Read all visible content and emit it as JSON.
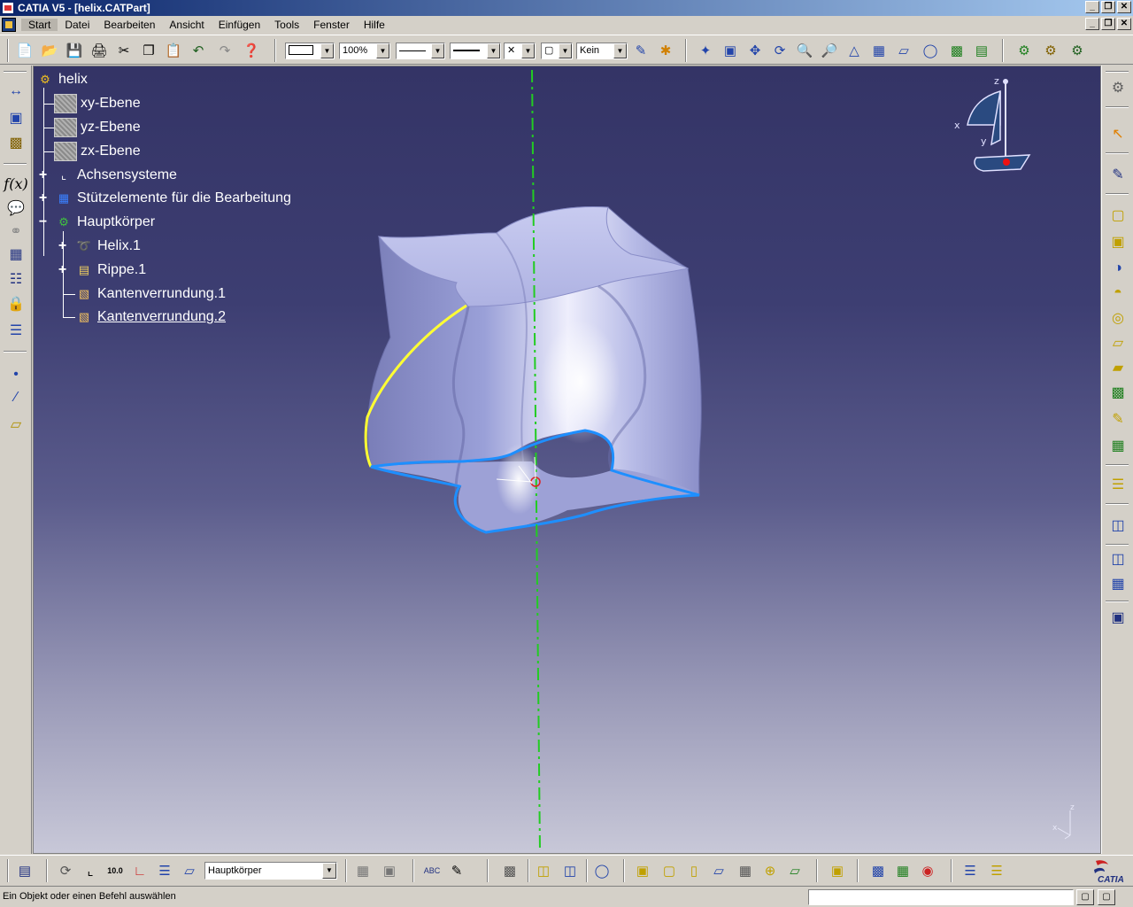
{
  "window": {
    "title": "CATIA V5 - [helix.CATPart]",
    "buttons": [
      "_",
      "❐",
      "✕"
    ]
  },
  "menubar": {
    "items": [
      "Start",
      "Datei",
      "Bearbeiten",
      "Ansicht",
      "Einfügen",
      "Tools",
      "Fenster",
      "Hilfe"
    ],
    "active": "Start",
    "doc_buttons": [
      "_",
      "❐",
      "✕"
    ]
  },
  "toolbar_top": {
    "zoom_value": "100%",
    "layer_value": "Kein"
  },
  "tree": {
    "root": "helix",
    "planes": [
      "xy-Ebene",
      "yz-Ebene",
      "zx-Ebene"
    ],
    "axis_systems": "Achsensysteme",
    "construction": "Stützelemente für die Bearbeitung",
    "main_body": "Hauptkörper",
    "features": [
      "Helix.1",
      "Rippe.1",
      "Kantenverrundung.1",
      "Kantenverrundung.2"
    ]
  },
  "compass": {
    "axis_x": "x",
    "axis_y": "y",
    "axis_z": "z"
  },
  "mini_axes": {
    "axis_x": "x",
    "axis_z": "z"
  },
  "toolbar_bottom": {
    "current_body": "Hauptkörper",
    "logo_text": "CATIA"
  },
  "statusbar": {
    "message": "Ein Objekt oder einen Befehl auswählen",
    "command_input": ""
  },
  "icons": {
    "top": [
      "new-icon",
      "open-icon",
      "save-icon",
      "print-icon",
      "cut-icon",
      "copy-icon",
      "paste-icon",
      "undo-icon",
      "redo-icon",
      "whats-this-icon",
      "fly-mode-icon",
      "fit-all-icon",
      "pan-icon",
      "rotate-icon",
      "zoom-in-icon",
      "zoom-out-icon",
      "normal-view-icon",
      "multi-view-icon",
      "iso-view-icon",
      "shading-icon",
      "hide-show-icon",
      "swap-space-icon",
      "knowledge-icon",
      "formula-icon",
      "publish-icon"
    ],
    "left": [
      "measure-between-icon",
      "measure-item-icon",
      "measure-inertia-icon",
      "formula-icon",
      "comment-icon",
      "link-icon",
      "table-icon",
      "design-table-icon",
      "lock-icon",
      "catalog-icon",
      "point-icon",
      "line-icon",
      "plane-icon"
    ],
    "right": [
      "settings-icon",
      "select-icon",
      "sketch-icon",
      "pad-icon",
      "pocket-icon",
      "shaft-icon",
      "groove-icon",
      "hole-icon",
      "rib-icon",
      "slot-icon",
      "stiffener-icon",
      "loft-icon",
      "fillet-icon",
      "draft-icon",
      "shell-icon",
      "thickness-icon",
      "pattern-icon",
      "scale-icon",
      "measure-icon"
    ],
    "bottom": [
      "update-icon",
      "undo-with-history-icon",
      "axis-system-icon",
      "numeric-table-icon",
      "constraint-icon",
      "body-icon",
      "stack-icon",
      "text-icon",
      "3d-annotation-icon",
      "view-icon",
      "measure-icon",
      "boolean-icon",
      "add-icon",
      "remove-icon",
      "intersect-icon",
      "solid-icon",
      "split-icon",
      "thick-surface-icon",
      "close-surface-icon",
      "sew-surface-icon",
      "target-icon",
      "apply-material-icon",
      "analysis-icon",
      "draft-analysis-icon",
      "curvature-icon",
      "rendering-icon",
      "scene-icon"
    ]
  },
  "colors": {
    "viewport_top": "#343466",
    "viewport_bottom": "#c8c8d8",
    "axis_line": "#22cc22",
    "selection_edge": "#1e8fff",
    "highlight_edge": "#ffff33",
    "part_surface": "#b8bce8"
  }
}
